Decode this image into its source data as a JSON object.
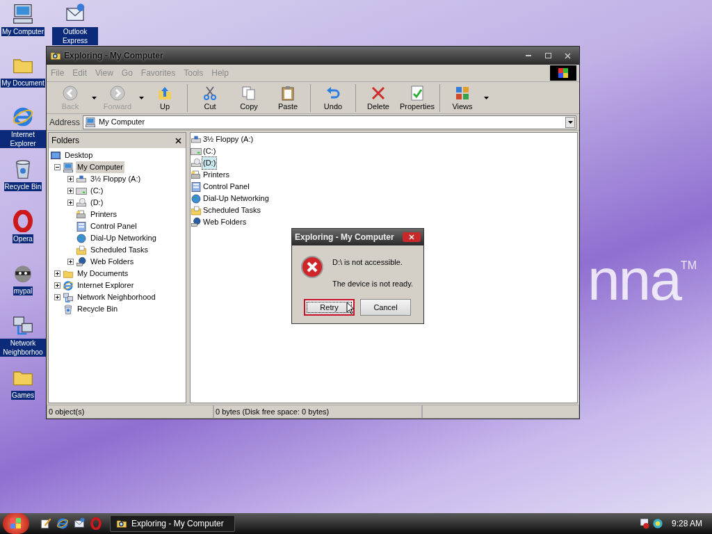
{
  "desktop": {
    "wallpaper_text": "nna",
    "wallpaper_mark": "TM",
    "icons": [
      {
        "kind": "computer",
        "label": "My Computer"
      },
      {
        "kind": "mail",
        "label": "Outlook Express"
      },
      {
        "kind": "folder",
        "label": "My Document"
      },
      {
        "kind": "ie",
        "label": "Internet Explorer"
      },
      {
        "kind": "bin",
        "label": "Recycle Bin"
      },
      {
        "kind": "opera",
        "label": "Opera"
      },
      {
        "kind": "raccoon",
        "label": "mypal"
      },
      {
        "kind": "network",
        "label": "Network Neighborhoo"
      },
      {
        "kind": "folder",
        "label": "Games"
      }
    ]
  },
  "window": {
    "title": "Exploring - My Computer",
    "menu": [
      "File",
      "Edit",
      "View",
      "Go",
      "Favorites",
      "Tools",
      "Help"
    ],
    "toolbar": [
      {
        "kind": "back",
        "label": "Back",
        "disabled": true,
        "dropdown": true
      },
      {
        "kind": "forward",
        "label": "Forward",
        "disabled": true,
        "dropdown": true
      },
      {
        "kind": "up",
        "label": "Up",
        "disabled": false,
        "dropdown": false
      },
      {
        "kind": "cut",
        "label": "Cut",
        "disabled": false,
        "dropdown": false
      },
      {
        "kind": "copy",
        "label": "Copy",
        "disabled": false,
        "dropdown": false
      },
      {
        "kind": "paste",
        "label": "Paste",
        "disabled": false,
        "dropdown": false
      },
      {
        "kind": "undo",
        "label": "Undo",
        "disabled": false,
        "dropdown": false
      },
      {
        "kind": "delete",
        "label": "Delete",
        "disabled": false,
        "dropdown": false
      },
      {
        "kind": "properties",
        "label": "Properties",
        "disabled": false,
        "dropdown": false
      },
      {
        "kind": "views",
        "label": "Views",
        "disabled": false,
        "dropdown": true
      }
    ],
    "address": {
      "label": "Address",
      "value": "My Computer"
    },
    "folders_pane": {
      "title": "Folders",
      "tree": [
        {
          "kind": "desktop",
          "label": "Desktop",
          "selected": false,
          "children": [
            {
              "kind": "computer",
              "label": "My Computer",
              "selected": true,
              "expanded": true,
              "children": [
                {
                  "kind": "floppy",
                  "label": "3½ Floppy (A:)",
                  "selected": false,
                  "expanded": false
                },
                {
                  "kind": "drive",
                  "label": "(C:)",
                  "selected": false,
                  "expanded": false
                },
                {
                  "kind": "cd",
                  "label": "(D:)",
                  "selected": false,
                  "expanded": false
                },
                {
                  "kind": "printer",
                  "label": "Printers",
                  "selected": false
                },
                {
                  "kind": "panel",
                  "label": "Control Panel",
                  "selected": false
                },
                {
                  "kind": "globe",
                  "label": "Dial-Up Networking",
                  "selected": false
                },
                {
                  "kind": "tasks",
                  "label": "Scheduled Tasks",
                  "selected": false
                },
                {
                  "kind": "webfolder",
                  "label": "Web Folders",
                  "selected": false,
                  "expanded": false
                }
              ]
            },
            {
              "kind": "folder",
              "label": "My Documents",
              "selected": false,
              "expanded": false
            },
            {
              "kind": "ie",
              "label": "Internet Explorer",
              "selected": false,
              "expanded": false
            },
            {
              "kind": "network",
              "label": "Network Neighborhood",
              "selected": false,
              "expanded": false
            },
            {
              "kind": "bin",
              "label": "Recycle Bin",
              "selected": false
            }
          ]
        }
      ]
    },
    "files": [
      {
        "kind": "floppy",
        "label": "3½ Floppy (A:)",
        "selected": false
      },
      {
        "kind": "drive",
        "label": "(C:)",
        "selected": false
      },
      {
        "kind": "cd",
        "label": "(D:)",
        "selected": true
      },
      {
        "kind": "printer",
        "label": "Printers",
        "selected": false
      },
      {
        "kind": "panel",
        "label": "Control Panel",
        "selected": false
      },
      {
        "kind": "globe",
        "label": "Dial-Up Networking",
        "selected": false
      },
      {
        "kind": "tasks",
        "label": "Scheduled Tasks",
        "selected": false
      },
      {
        "kind": "webfolder",
        "label": "Web Folders",
        "selected": false
      }
    ],
    "status_bar": [
      "0 object(s)",
      "0 bytes (Disk free space: 0 bytes)"
    ]
  },
  "dialog": {
    "title": "Exploring - My Computer",
    "messages": [
      "D:\\ is not accessible.",
      "The device is not ready."
    ],
    "buttons": [
      {
        "label": "Retry",
        "selected": true
      },
      {
        "label": "Cancel",
        "selected": false
      }
    ]
  },
  "taskbar": {
    "quick_launch": [
      {
        "kind": "edit"
      },
      {
        "kind": "ie"
      },
      {
        "kind": "mail"
      },
      {
        "kind": "opera"
      }
    ],
    "task": "Exploring - My Computer",
    "clock": "9:28 AM"
  }
}
